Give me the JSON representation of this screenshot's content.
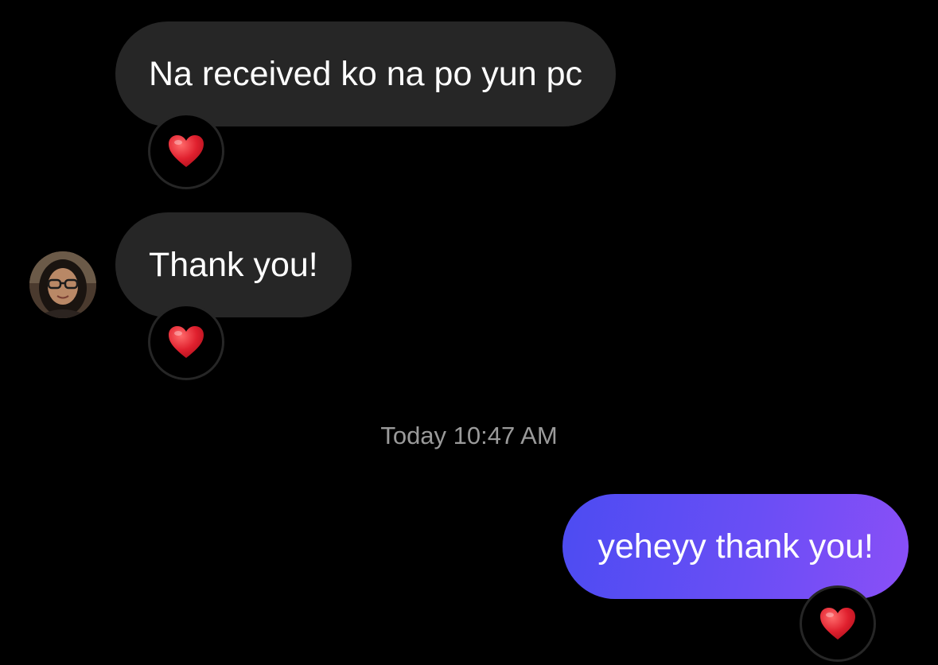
{
  "conversation": {
    "messages": [
      {
        "sender": "them",
        "text": "Na received ko na po yun pc",
        "reaction": "heart"
      },
      {
        "sender": "them",
        "text": "Thank you!",
        "reaction": "heart"
      },
      {
        "sender": "me",
        "text": "yeheyy thank you!",
        "reaction": "heart"
      }
    ],
    "timestamp": "Today 10:47 AM"
  },
  "colors": {
    "background": "#000000",
    "incoming_bubble": "#262626",
    "outgoing_gradient_start": "#4c4cf2",
    "outgoing_gradient_end": "#8a4ff7",
    "timestamp_text": "#9a9a9a",
    "heart": "#e0202e"
  },
  "icons": {
    "reaction": "red-heart-icon",
    "avatar": "contact-avatar"
  }
}
